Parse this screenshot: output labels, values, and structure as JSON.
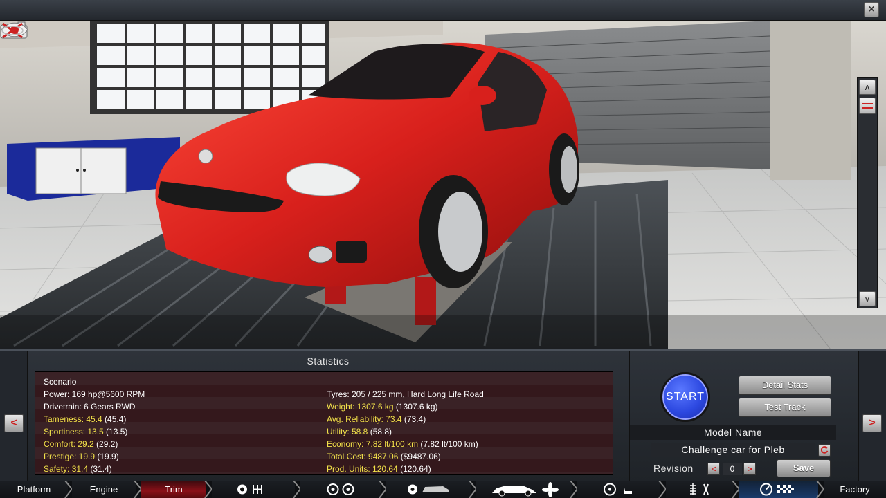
{
  "window": {
    "close_symbol": "×"
  },
  "scene": {
    "icons": [
      "camera-icon",
      "eye-icon",
      "reset-view-icon"
    ],
    "scroll_up": "ʌ",
    "scroll_down": "v"
  },
  "panel": {
    "prev_symbol": "<",
    "next_symbol": ">",
    "statistics_title": "Statistics",
    "stats_left": [
      {
        "label": "Scenario",
        "raw": "",
        "highlight": false
      },
      {
        "label": "Power: 169 hp@5600 RPM",
        "raw": "",
        "highlight": false
      },
      {
        "label": "Drivetrain: 6 Gears RWD",
        "raw": "",
        "highlight": false
      },
      {
        "label": "Tameness: 45.4",
        "raw": " (45.4)",
        "highlight": true
      },
      {
        "label": "Sportiness: 13.5",
        "raw": " (13.5)",
        "highlight": true
      },
      {
        "label": "Comfort: 29.2",
        "raw": " (29.2)",
        "highlight": true
      },
      {
        "label": "Prestige: 19.9",
        "raw": " (19.9)",
        "highlight": true
      },
      {
        "label": "Safety: 31.4",
        "raw": " (31.4)",
        "highlight": true
      }
    ],
    "stats_right": [
      {
        "label": "",
        "raw": "",
        "highlight": false
      },
      {
        "label": "Tyres: 205 / 225 mm, Hard Long Life Road",
        "raw": "",
        "highlight": false
      },
      {
        "label": "Weight: 1307.6 kg",
        "raw": " (1307.6 kg)",
        "highlight": true
      },
      {
        "label": "Avg. Reliability: 73.4",
        "raw": " (73.4)",
        "highlight": true
      },
      {
        "label": "Utility: 58.8",
        "raw": " (58.8)",
        "highlight": true
      },
      {
        "label": "Economy: 7.82 lt/100 km",
        "raw": " (7.82 lt/100 km)",
        "highlight": true
      },
      {
        "label": "Total Cost: 9487.06",
        "raw": " ($9487.06)",
        "highlight": true
      },
      {
        "label": "Prod. Units: 120.64",
        "raw": " (120.64)",
        "highlight": true
      }
    ],
    "start_label": "START",
    "detail_stats_label": "Detail Stats",
    "test_track_label": "Test Track",
    "model_name_title": "Model Name",
    "model_name_value": "Challenge car for Pleb",
    "revision_label": "Revision",
    "revision_value": "0",
    "rev_minus": "<",
    "rev_plus": ">",
    "save_label": "Save"
  },
  "nav": {
    "tabs": [
      "Platform",
      "Engine",
      "Trim",
      "Factory"
    ],
    "active_tab": "Trim",
    "icon_groups": [
      [
        "gear-icon",
        "gearbox-icon"
      ],
      [
        "wheel-icon",
        "wheel-icon"
      ],
      [
        "brake-icon",
        "car-body-icon"
      ],
      [
        "car-icon",
        "fan-icon"
      ],
      [
        "steering-wheel-icon",
        "seat-icon"
      ],
      [
        "suspension-icon",
        "tools-icon"
      ],
      [
        "gauge-icon",
        "checkered-flag-icon"
      ]
    ]
  },
  "colors": {
    "car": "#d8201c",
    "highlight_text": "#f2e14a",
    "start_button": "#2c48e0",
    "active_tab": "#8a1018"
  }
}
